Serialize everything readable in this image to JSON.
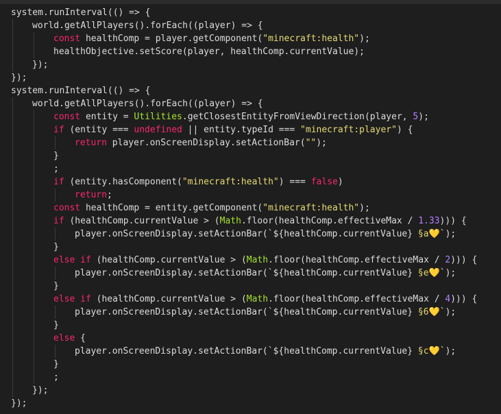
{
  "theme": {
    "background": "#1e1e1e",
    "plain": "#dcdcdc",
    "keyword": "#f92672",
    "string": "#e6db74",
    "number": "#ae81ff",
    "type": "#a6e22e"
  },
  "code_lines": [
    {
      "indent": 0,
      "tokens": [
        {
          "t": "system.runInterval(() => {",
          "c": "p"
        }
      ]
    },
    {
      "indent": 1,
      "tokens": [
        {
          "t": "world.getAllPlayers().forEach((player) => {",
          "c": "p"
        }
      ]
    },
    {
      "indent": 2,
      "tokens": [
        {
          "t": "const",
          "c": "k"
        },
        {
          "t": " healthComp = player.getComponent(",
          "c": "p"
        },
        {
          "t": "\"minecraft:health\"",
          "c": "s"
        },
        {
          "t": ");",
          "c": "p"
        }
      ]
    },
    {
      "indent": 2,
      "tokens": [
        {
          "t": "healthObjective.setScore(player, healthComp.currentValue);",
          "c": "p"
        }
      ]
    },
    {
      "indent": 1,
      "tokens": [
        {
          "t": "});",
          "c": "p"
        }
      ]
    },
    {
      "indent": 0,
      "tokens": [
        {
          "t": "});",
          "c": "p"
        }
      ]
    },
    {
      "indent": 0,
      "tokens": [
        {
          "t": "system.runInterval(() => {",
          "c": "p"
        }
      ]
    },
    {
      "indent": 1,
      "tokens": [
        {
          "t": "world.getAllPlayers().forEach((player) => {",
          "c": "p"
        }
      ]
    },
    {
      "indent": 2,
      "tokens": [
        {
          "t": "const",
          "c": "k"
        },
        {
          "t": " entity = ",
          "c": "p"
        },
        {
          "t": "Utilities",
          "c": "t"
        },
        {
          "t": ".getClosestEntityFromViewDirection(player, ",
          "c": "p"
        },
        {
          "t": "5",
          "c": "n"
        },
        {
          "t": ");",
          "c": "p"
        }
      ]
    },
    {
      "indent": 2,
      "tokens": [
        {
          "t": "if",
          "c": "k"
        },
        {
          "t": " (entity === ",
          "c": "p"
        },
        {
          "t": "undefined",
          "c": "k"
        },
        {
          "t": " || entity.typeId === ",
          "c": "p"
        },
        {
          "t": "\"minecraft:player\"",
          "c": "s"
        },
        {
          "t": ") {",
          "c": "p"
        }
      ]
    },
    {
      "indent": 3,
      "tokens": [
        {
          "t": "return",
          "c": "k"
        },
        {
          "t": " player.onScreenDisplay.setActionBar(",
          "c": "p"
        },
        {
          "t": "\"\"",
          "c": "s"
        },
        {
          "t": ");",
          "c": "p"
        }
      ]
    },
    {
      "indent": 2,
      "tokens": [
        {
          "t": "}",
          "c": "p"
        }
      ]
    },
    {
      "indent": 2,
      "tokens": [
        {
          "t": ";",
          "c": "p"
        }
      ]
    },
    {
      "indent": 2,
      "tokens": [
        {
          "t": "if",
          "c": "k"
        },
        {
          "t": " (entity.hasComponent(",
          "c": "p"
        },
        {
          "t": "\"minecraft:health\"",
          "c": "s"
        },
        {
          "t": ") === ",
          "c": "p"
        },
        {
          "t": "false",
          "c": "k"
        },
        {
          "t": ")",
          "c": "p"
        }
      ]
    },
    {
      "indent": 3,
      "tokens": [
        {
          "t": "return",
          "c": "k"
        },
        {
          "t": ";",
          "c": "p"
        }
      ]
    },
    {
      "indent": 2,
      "tokens": [
        {
          "t": "const",
          "c": "k"
        },
        {
          "t": " healthComp = entity.getComponent(",
          "c": "p"
        },
        {
          "t": "\"minecraft:health\"",
          "c": "s"
        },
        {
          "t": ");",
          "c": "p"
        }
      ]
    },
    {
      "indent": 2,
      "tokens": [
        {
          "t": "if",
          "c": "k"
        },
        {
          "t": " (healthComp.currentValue > (",
          "c": "p"
        },
        {
          "t": "Math",
          "c": "t"
        },
        {
          "t": ".floor(healthComp.effectiveMax / ",
          "c": "p"
        },
        {
          "t": "1.33",
          "c": "n"
        },
        {
          "t": "))) {",
          "c": "p"
        }
      ]
    },
    {
      "indent": 3,
      "tokens": [
        {
          "t": "player.onScreenDisplay.setActionBar(",
          "c": "p"
        },
        {
          "t": "`${healthComp.currentValue} ",
          "c": "p"
        },
        {
          "t": "§a💛",
          "c": "s"
        },
        {
          "t": "`);",
          "c": "p"
        }
      ]
    },
    {
      "indent": 2,
      "tokens": [
        {
          "t": "}",
          "c": "p"
        }
      ]
    },
    {
      "indent": 2,
      "tokens": [
        {
          "t": "else if",
          "c": "k"
        },
        {
          "t": " (healthComp.currentValue > (",
          "c": "p"
        },
        {
          "t": "Math",
          "c": "t"
        },
        {
          "t": ".floor(healthComp.effectiveMax / ",
          "c": "p"
        },
        {
          "t": "2",
          "c": "n"
        },
        {
          "t": "))) {",
          "c": "p"
        }
      ]
    },
    {
      "indent": 3,
      "tokens": [
        {
          "t": "player.onScreenDisplay.setActionBar(",
          "c": "p"
        },
        {
          "t": "`${healthComp.currentValue} ",
          "c": "p"
        },
        {
          "t": "§e💛",
          "c": "s"
        },
        {
          "t": "`);",
          "c": "p"
        }
      ]
    },
    {
      "indent": 2,
      "tokens": [
        {
          "t": "}",
          "c": "p"
        }
      ]
    },
    {
      "indent": 2,
      "tokens": [
        {
          "t": "else if",
          "c": "k"
        },
        {
          "t": " (healthComp.currentValue > (",
          "c": "p"
        },
        {
          "t": "Math",
          "c": "t"
        },
        {
          "t": ".floor(healthComp.effectiveMax / ",
          "c": "p"
        },
        {
          "t": "4",
          "c": "n"
        },
        {
          "t": "))) {",
          "c": "p"
        }
      ]
    },
    {
      "indent": 3,
      "tokens": [
        {
          "t": "player.onScreenDisplay.setActionBar(",
          "c": "p"
        },
        {
          "t": "`${healthComp.currentValue} ",
          "c": "p"
        },
        {
          "t": "§6💛",
          "c": "s"
        },
        {
          "t": "`);",
          "c": "p"
        }
      ]
    },
    {
      "indent": 2,
      "tokens": [
        {
          "t": "}",
          "c": "p"
        }
      ]
    },
    {
      "indent": 2,
      "tokens": [
        {
          "t": "else",
          "c": "k"
        },
        {
          "t": " {",
          "c": "p"
        }
      ]
    },
    {
      "indent": 3,
      "tokens": [
        {
          "t": "player.onScreenDisplay.setActionBar(",
          "c": "p"
        },
        {
          "t": "`${healthComp.currentValue} ",
          "c": "p"
        },
        {
          "t": "§c💛",
          "c": "s"
        },
        {
          "t": "`);",
          "c": "p"
        }
      ]
    },
    {
      "indent": 2,
      "tokens": [
        {
          "t": "}",
          "c": "p"
        }
      ]
    },
    {
      "indent": 2,
      "tokens": [
        {
          "t": ";",
          "c": "p"
        }
      ]
    },
    {
      "indent": 1,
      "tokens": [
        {
          "t": "});",
          "c": "p"
        }
      ]
    },
    {
      "indent": 0,
      "tokens": [
        {
          "t": "});",
          "c": "p"
        }
      ]
    }
  ]
}
